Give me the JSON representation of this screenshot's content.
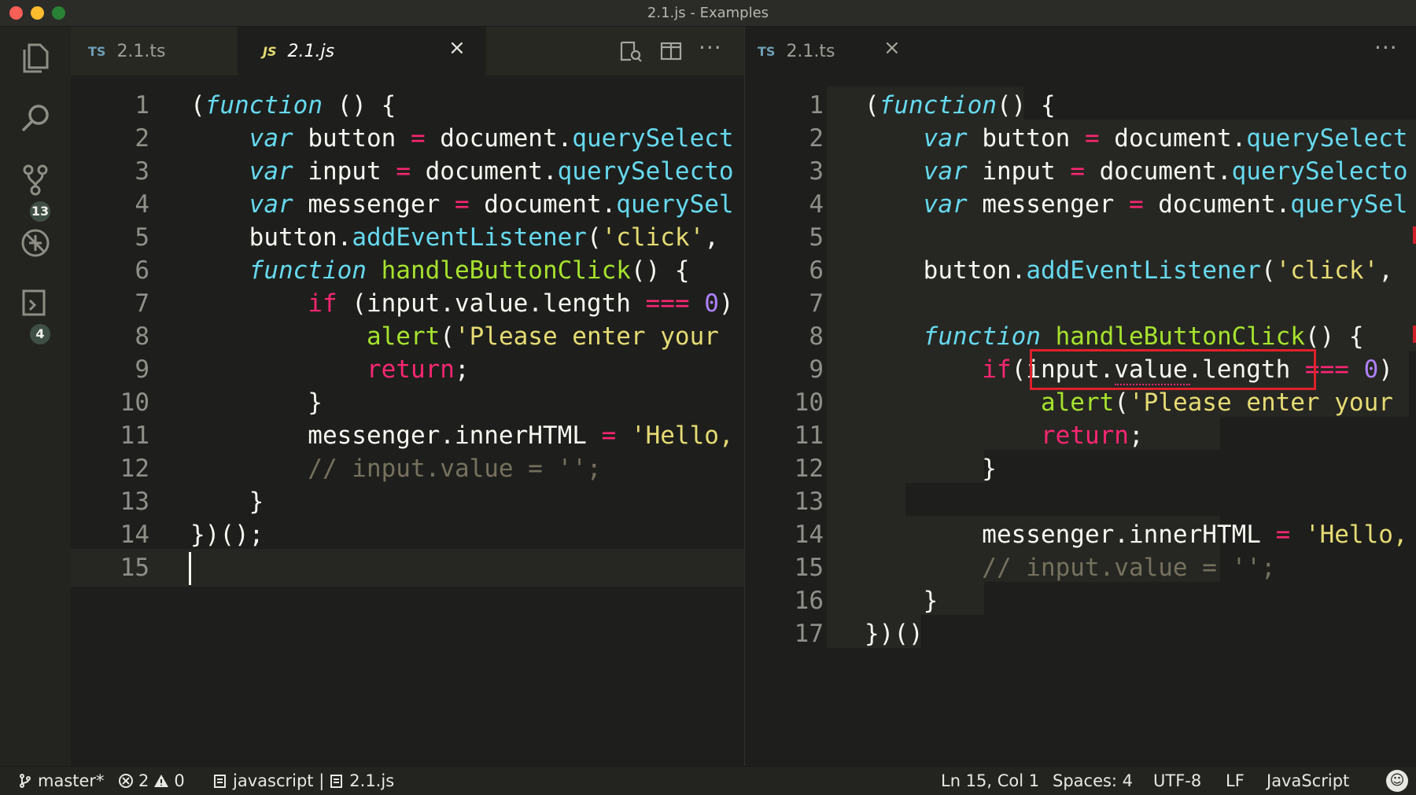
{
  "window": {
    "title": "2.1.js - Examples"
  },
  "activity_bar": {
    "items": [
      {
        "icon": "files-icon"
      },
      {
        "icon": "search-icon"
      },
      {
        "icon": "source-control-icon",
        "badge": "13"
      },
      {
        "icon": "debug-icon"
      },
      {
        "icon": "extensions-icon",
        "badge": "4"
      }
    ]
  },
  "left_pane": {
    "tabs": [
      {
        "lang": "TS",
        "label": "2.1.ts",
        "active": false
      },
      {
        "lang": "JS",
        "label": "2.1.js",
        "active": true
      }
    ],
    "close_label": "×",
    "more_label": "···",
    "cursor_line": 15,
    "lines": [
      {
        "n": "1",
        "tokens": [
          [
            "pl",
            "("
          ],
          [
            "kw",
            "function"
          ],
          [
            "pl",
            " () {"
          ]
        ]
      },
      {
        "n": "2",
        "tokens": [
          [
            "pl",
            "    "
          ],
          [
            "kw",
            "var"
          ],
          [
            "pl",
            " button "
          ],
          [
            "op",
            "="
          ],
          [
            "pl",
            " document."
          ],
          [
            "mth",
            "querySelect"
          ]
        ]
      },
      {
        "n": "3",
        "tokens": [
          [
            "pl",
            "    "
          ],
          [
            "kw",
            "var"
          ],
          [
            "pl",
            " input "
          ],
          [
            "op",
            "="
          ],
          [
            "pl",
            " document."
          ],
          [
            "mth",
            "querySelecto"
          ]
        ]
      },
      {
        "n": "4",
        "tokens": [
          [
            "pl",
            "    "
          ],
          [
            "kw",
            "var"
          ],
          [
            "pl",
            " messenger "
          ],
          [
            "op",
            "="
          ],
          [
            "pl",
            " document."
          ],
          [
            "mth",
            "querySel"
          ]
        ]
      },
      {
        "n": "5",
        "tokens": [
          [
            "pl",
            "    button."
          ],
          [
            "mth",
            "addEventListener"
          ],
          [
            "pl",
            "("
          ],
          [
            "str",
            "'click'"
          ],
          [
            "pl",
            ","
          ]
        ]
      },
      {
        "n": "6",
        "tokens": [
          [
            "pl",
            "    "
          ],
          [
            "kw",
            "function"
          ],
          [
            "pl",
            " "
          ],
          [
            "fn",
            "handleButtonClick"
          ],
          [
            "pl",
            "() {"
          ]
        ]
      },
      {
        "n": "7",
        "tokens": [
          [
            "pl",
            "        "
          ],
          [
            "ret",
            "if"
          ],
          [
            "pl",
            " (input.value.length "
          ],
          [
            "op",
            "==="
          ],
          [
            "pl",
            " "
          ],
          [
            "num",
            "0"
          ],
          [
            "pl",
            ")"
          ]
        ]
      },
      {
        "n": "8",
        "tokens": [
          [
            "pl",
            "            "
          ],
          [
            "fn",
            "alert"
          ],
          [
            "pl",
            "("
          ],
          [
            "str",
            "'Please enter your"
          ]
        ]
      },
      {
        "n": "9",
        "tokens": [
          [
            "pl",
            "            "
          ],
          [
            "ret",
            "return"
          ],
          [
            "pl",
            ";"
          ]
        ]
      },
      {
        "n": "10",
        "tokens": [
          [
            "pl",
            "        }"
          ]
        ]
      },
      {
        "n": "11",
        "tokens": [
          [
            "pl",
            "        messenger.innerHTML "
          ],
          [
            "op",
            "="
          ],
          [
            "pl",
            " "
          ],
          [
            "str",
            "'Hello,"
          ]
        ]
      },
      {
        "n": "12",
        "tokens": [
          [
            "cmt",
            "        // input.value = '';"
          ]
        ]
      },
      {
        "n": "13",
        "tokens": [
          [
            "pl",
            "    }"
          ]
        ]
      },
      {
        "n": "14",
        "tokens": [
          [
            "pl",
            "})();"
          ]
        ]
      },
      {
        "n": "15",
        "tokens": []
      }
    ]
  },
  "right_pane": {
    "tabs": [
      {
        "lang": "TS",
        "label": "2.1.ts",
        "active": true
      }
    ],
    "close_label": "×",
    "more_label": "···",
    "lines": [
      {
        "n": "1",
        "tokens": [
          [
            "pl",
            "("
          ],
          [
            "kw",
            "function"
          ],
          [
            "pl",
            "() {"
          ]
        ]
      },
      {
        "n": "2",
        "tokens": [
          [
            "pl",
            "    "
          ],
          [
            "kw",
            "var"
          ],
          [
            "pl",
            " button "
          ],
          [
            "op",
            "="
          ],
          [
            "pl",
            " document."
          ],
          [
            "mth",
            "querySelect"
          ]
        ]
      },
      {
        "n": "3",
        "tokens": [
          [
            "pl",
            "    "
          ],
          [
            "kw",
            "var"
          ],
          [
            "pl",
            " input "
          ],
          [
            "op",
            "="
          ],
          [
            "pl",
            " document."
          ],
          [
            "mth",
            "querySelecto"
          ]
        ]
      },
      {
        "n": "4",
        "tokens": [
          [
            "pl",
            "    "
          ],
          [
            "kw",
            "var"
          ],
          [
            "pl",
            " messenger "
          ],
          [
            "op",
            "="
          ],
          [
            "pl",
            " document."
          ],
          [
            "mth",
            "querySel"
          ]
        ]
      },
      {
        "n": "5",
        "tokens": []
      },
      {
        "n": "6",
        "tokens": [
          [
            "pl",
            "    button."
          ],
          [
            "mth",
            "addEventListener"
          ],
          [
            "pl",
            "("
          ],
          [
            "str",
            "'click'"
          ],
          [
            "pl",
            ","
          ]
        ]
      },
      {
        "n": "7",
        "tokens": []
      },
      {
        "n": "8",
        "tokens": [
          [
            "pl",
            "    "
          ],
          [
            "kw",
            "function"
          ],
          [
            "pl",
            " "
          ],
          [
            "fn",
            "handleButtonClick"
          ],
          [
            "pl",
            "() {"
          ]
        ]
      },
      {
        "n": "9",
        "tokens": [
          [
            "pl",
            "        "
          ],
          [
            "ret",
            "if"
          ],
          [
            "pl",
            "(input.value.length "
          ],
          [
            "op",
            "==="
          ],
          [
            "pl",
            " "
          ],
          [
            "num",
            "0"
          ],
          [
            "pl",
            ")"
          ]
        ]
      },
      {
        "n": "10",
        "tokens": [
          [
            "pl",
            "            "
          ],
          [
            "fn",
            "alert"
          ],
          [
            "pl",
            "("
          ],
          [
            "str",
            "'Please enter your"
          ]
        ]
      },
      {
        "n": "11",
        "tokens": [
          [
            "pl",
            "            "
          ],
          [
            "ret",
            "return"
          ],
          [
            "pl",
            ";"
          ]
        ]
      },
      {
        "n": "12",
        "tokens": [
          [
            "pl",
            "        }"
          ]
        ]
      },
      {
        "n": "13",
        "tokens": []
      },
      {
        "n": "14",
        "tokens": [
          [
            "pl",
            "        messenger.innerHTML "
          ],
          [
            "op",
            "="
          ],
          [
            "pl",
            " "
          ],
          [
            "str",
            "'Hello,"
          ]
        ]
      },
      {
        "n": "15",
        "tokens": [
          [
            "cmt",
            "        // input.value = '';"
          ]
        ]
      },
      {
        "n": "16",
        "tokens": [
          [
            "pl",
            "    }"
          ]
        ]
      },
      {
        "n": "17",
        "tokens": [
          [
            "pl",
            "})()"
          ]
        ]
      }
    ]
  },
  "status_bar": {
    "branch": "master*",
    "errors": "2",
    "warnings": "0",
    "context": "javascript | ",
    "file": "2.1.js",
    "position": "Ln 15, Col 1",
    "spaces": "Spaces: 4",
    "encoding": "UTF-8",
    "eol": "LF",
    "language": "JavaScript"
  },
  "colors": {
    "background": "#1e1f1c",
    "keyword": "#66d9ef",
    "control": "#f92672",
    "function": "#a6e22e",
    "string": "#e6db74",
    "number": "#ae81ff",
    "comment": "#75715e",
    "highlight_box": "#e0202a"
  }
}
